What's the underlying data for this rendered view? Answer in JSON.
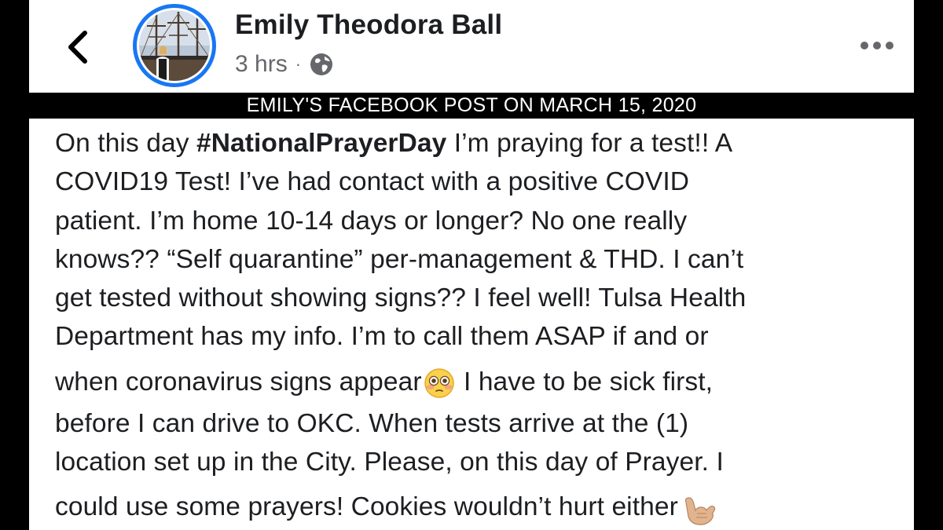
{
  "header": {
    "author_name": "Emily Theodora Ball",
    "timestamp": "3 hrs",
    "separator": "·",
    "privacy_icon": "globe-icon",
    "back_icon": "chevron-left-icon",
    "more_icon": "more-horizontal-icon"
  },
  "banner": {
    "text": "EMILY'S FACEBOOK POST ON MARCH 15, 2020"
  },
  "post": {
    "lines": [
      {
        "before": "On this day ",
        "hashtag": "#NationalPrayerDay",
        "after": " I’m praying for a test!! A"
      },
      {
        "text": "COVID19 Test! I’ve had contact with a positive COVID"
      },
      {
        "text": "patient. I’m home 10-14 days or longer? No one really"
      },
      {
        "text": "knows?? “Self quarantine” per-management & THD. I can’t"
      },
      {
        "text": "get tested without showing signs?? I feel well! Tulsa Health"
      },
      {
        "text": "Department has my info. I’m to call them ASAP if and or"
      },
      {
        "before": "when coronavirus signs appear",
        "emoji": "flushed-face-emoji",
        "after": " I have to be sick first,"
      },
      {
        "text": "before I can drive to OKC. When tests arrive at the (1)"
      },
      {
        "text": "location set up in the City. Please, on this day of Prayer. I"
      },
      {
        "before": "could use some prayers! Cookies wouldn’t hurt either",
        "emoji": "call-me-hand-emoji",
        "after": ""
      }
    ]
  },
  "colors": {
    "accent": "#1877f2",
    "text_primary": "#1c1e21",
    "text_secondary": "#65676b",
    "letterbox": "#000000"
  }
}
